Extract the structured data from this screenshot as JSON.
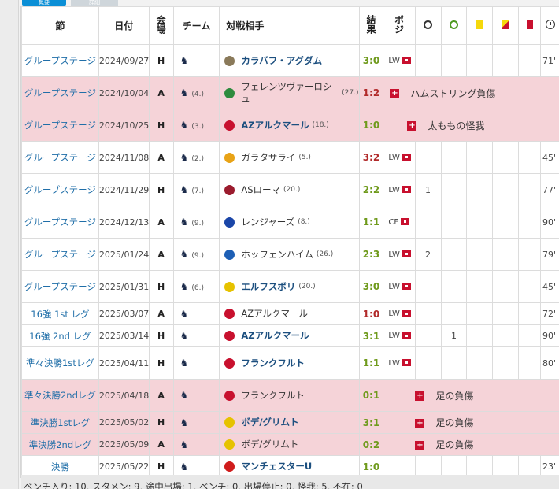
{
  "tabs": {
    "active": "概要",
    "inactive": "詳細"
  },
  "headers": {
    "round": "節",
    "date": "日付",
    "venue": "会場",
    "team": "チーム",
    "opponent": "対戦相手",
    "result": "結果",
    "position": "ポジ",
    "goals_icon": "ball-icon",
    "assists_icon": "assist-icon",
    "yellow_icon": "yellow-card-icon",
    "second_yellow_icon": "second-yellow-icon",
    "red_icon": "red-card-icon",
    "minutes_icon": "clock-icon"
  },
  "rows": [
    {
      "round": "グループステージ",
      "date": "2024/09/27",
      "venue": "H",
      "team_rank": "",
      "opponent": "カラバフ・アグダム",
      "opp_rank": "",
      "opp_bold": true,
      "crest": "#8a7a5a",
      "score": "3:0",
      "res": "w",
      "pos": "LW",
      "goals": "",
      "assists": "",
      "minutes": "71'",
      "injury": ""
    },
    {
      "round": "グループステージ",
      "date": "2024/10/04",
      "venue": "A",
      "team_rank": "(4.)",
      "opponent": "フェレンツヴァーロシュ",
      "opp_rank": "(27.)",
      "opp_bold": false,
      "crest": "#2e8b3e",
      "score": "1:2",
      "res": "l",
      "pos": "",
      "goals": "",
      "assists": "",
      "minutes": "",
      "injury": "ハムストリング負傷"
    },
    {
      "round": "グループステージ",
      "date": "2024/10/25",
      "venue": "H",
      "team_rank": "(3.)",
      "opponent": "AZアルクマール",
      "opp_rank": "(18.)",
      "opp_bold": true,
      "crest": "#c8102e",
      "score": "1:0",
      "res": "w",
      "pos": "",
      "goals": "",
      "assists": "",
      "minutes": "",
      "injury": "太ももの怪我"
    },
    {
      "round": "グループステージ",
      "date": "2024/11/08",
      "venue": "A",
      "team_rank": "(2.)",
      "opponent": "ガラタサライ",
      "opp_rank": "(5.)",
      "opp_bold": false,
      "crest": "#e8a317",
      "score": "3:2",
      "res": "l",
      "pos": "LW",
      "goals": "",
      "assists": "",
      "minutes": "45'",
      "injury": ""
    },
    {
      "round": "グループステージ",
      "date": "2024/11/29",
      "venue": "H",
      "team_rank": "(7.)",
      "opponent": "ASローマ",
      "opp_rank": "(20.)",
      "opp_bold": false,
      "crest": "#9b1c2e",
      "score": "2:2",
      "res": "d",
      "pos": "LW",
      "goals": "1",
      "assists": "",
      "minutes": "77'",
      "injury": ""
    },
    {
      "round": "グループステージ",
      "date": "2024/12/13",
      "venue": "A",
      "team_rank": "(9.)",
      "opponent": "レンジャーズ",
      "opp_rank": "(8.)",
      "opp_bold": false,
      "crest": "#1b46a8",
      "score": "1:1",
      "res": "d",
      "pos": "CF",
      "goals": "",
      "assists": "",
      "minutes": "90'",
      "injury": ""
    },
    {
      "round": "グループステージ",
      "date": "2025/01/24",
      "venue": "A",
      "team_rank": "(9.)",
      "opponent": "ホッフェンハイム",
      "opp_rank": "(26.)",
      "opp_bold": false,
      "crest": "#1d5fb5",
      "score": "2:3",
      "res": "w",
      "pos": "LW",
      "goals": "2",
      "assists": "",
      "minutes": "79'",
      "injury": ""
    },
    {
      "round": "グループステージ",
      "date": "2025/01/31",
      "venue": "H",
      "team_rank": "(6.)",
      "opponent": "エルフスボリ",
      "opp_rank": "(20.)",
      "opp_bold": true,
      "crest": "#e6c200",
      "score": "3:0",
      "res": "w",
      "pos": "LW",
      "goals": "",
      "assists": "",
      "minutes": "45'",
      "injury": ""
    },
    {
      "round": "16強 1st レグ",
      "date": "2025/03/07",
      "venue": "A",
      "team_rank": "",
      "opponent": "AZアルクマール",
      "opp_rank": "",
      "opp_bold": false,
      "crest": "#c8102e",
      "score": "1:0",
      "res": "l",
      "pos": "LW",
      "goals": "",
      "assists": "",
      "minutes": "72'",
      "injury": ""
    },
    {
      "round": "16強 2nd レグ",
      "date": "2025/03/14",
      "venue": "H",
      "team_rank": "",
      "opponent": "AZアルクマール",
      "opp_rank": "",
      "opp_bold": true,
      "crest": "#c8102e",
      "score": "3:1",
      "res": "w",
      "pos": "LW",
      "goals": "",
      "assists": "1",
      "minutes": "90'",
      "injury": ""
    },
    {
      "round": "準々決勝1stレグ",
      "date": "2025/04/11",
      "venue": "H",
      "team_rank": "",
      "opponent": "フランクフルト",
      "opp_rank": "",
      "opp_bold": true,
      "crest": "#c8102e",
      "score": "1:1",
      "res": "d",
      "pos": "LW",
      "goals": "",
      "assists": "",
      "minutes": "80'",
      "injury": ""
    },
    {
      "round": "準々決勝2ndレグ",
      "date": "2025/04/18",
      "venue": "A",
      "team_rank": "",
      "opponent": "フランクフルト",
      "opp_rank": "",
      "opp_bold": false,
      "crest": "#c8102e",
      "score": "0:1",
      "res": "w",
      "pos": "",
      "goals": "",
      "assists": "",
      "minutes": "",
      "injury": "足の負傷"
    },
    {
      "round": "準決勝1stレグ",
      "date": "2025/05/02",
      "venue": "H",
      "team_rank": "",
      "opponent": "ボデ/グリムト",
      "opp_rank": "",
      "opp_bold": true,
      "crest": "#e6c200",
      "score": "3:1",
      "res": "w",
      "pos": "",
      "goals": "",
      "assists": "",
      "minutes": "",
      "injury": "足の負傷"
    },
    {
      "round": "準決勝2ndレグ",
      "date": "2025/05/09",
      "venue": "A",
      "team_rank": "",
      "opponent": "ボデ/グリムト",
      "opp_rank": "",
      "opp_bold": false,
      "crest": "#e6c200",
      "score": "0:2",
      "res": "w",
      "pos": "",
      "goals": "",
      "assists": "",
      "minutes": "",
      "injury": "足の負傷"
    },
    {
      "round": "決勝",
      "date": "2025/05/22",
      "venue": "H",
      "team_rank": "",
      "opponent": "マンチェスターU",
      "opp_rank": "",
      "opp_bold": true,
      "crest": "#d01c1c",
      "score": "1:0",
      "res": "w",
      "pos": "",
      "goals": "",
      "assists": "",
      "minutes": "23'",
      "injury": ""
    }
  ],
  "footer": "ベンチ入り: 10, スタメン: 9, 途中出場: 1, ベンチ: 0, 出場停止: 0, 怪我: 5, 不在: 0"
}
